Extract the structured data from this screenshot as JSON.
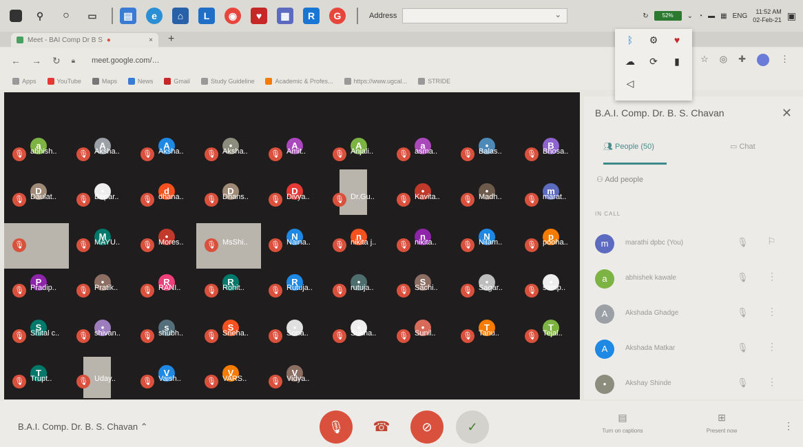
{
  "taskbar": {
    "address_label": "Address",
    "battery": "52%",
    "lang": "ENG",
    "time": "11:52 AM",
    "date": "02-Feb-21"
  },
  "browser": {
    "tab_title": "Meet - BAI Comp Dr B S",
    "url": "meet.google.com/…",
    "bookmarks": [
      "Apps",
      "YouTube",
      "Maps",
      "News",
      "Gmail",
      "Study Guideline",
      "Academic & Profes...",
      "https://www.ugcal...",
      "STRIDE"
    ]
  },
  "grid": [
    {
      "row": 0,
      "tiles": [
        {
          "l": "a",
          "n": "abhish..",
          "c": "#7cb342"
        },
        {
          "l": "A",
          "n": "Aksha..",
          "c": "#9aa0a6"
        },
        {
          "l": "A",
          "n": "Aksha..",
          "c": "#1e88e5"
        },
        {
          "l": "•",
          "n": "Aksha..",
          "c": "#8d8d7d"
        },
        {
          "l": "A",
          "n": "Amit..",
          "c": "#ab47bc"
        },
        {
          "l": "A",
          "n": "Anjali..",
          "c": "#7cb342"
        },
        {
          "l": "a",
          "n": "asma..",
          "c": "#ab47bc"
        },
        {
          "l": "•",
          "n": "Balas..",
          "c": "#4e8ab8"
        },
        {
          "l": "B",
          "n": "Bhosa..",
          "c": "#8e63ce"
        }
      ]
    },
    {
      "row": 1,
      "tiles": [
        {
          "l": "D",
          "n": "Daulat..",
          "c": "#9e8a76"
        },
        {
          "l": "•",
          "n": "Depar..",
          "c": "#eeeeee"
        },
        {
          "l": "d",
          "n": "dhana..",
          "c": "#f4511e"
        },
        {
          "l": "D",
          "n": "Dhans..",
          "c": "#9e8a76"
        },
        {
          "l": "D",
          "n": "Divya..",
          "c": "#e53935"
        },
        {
          "l": "",
          "n": "Dr.Gu..",
          "c": "#b9b5ad"
        },
        {
          "l": "•",
          "n": "Kavita..",
          "c": "#c0392b"
        },
        {
          "l": "•",
          "n": "Madh..",
          "c": "#6d5a4a"
        },
        {
          "l": "m",
          "n": "marat..",
          "c": "#5c6bc0"
        }
      ]
    },
    {
      "row": 2,
      "tiles": [
        {
          "l": "",
          "n": "",
          "c": "#b9b5ad"
        },
        {
          "l": "M",
          "n": "MAYU..",
          "c": "#00796b"
        },
        {
          "l": "•",
          "n": "Mores..",
          "c": "#c0392b"
        },
        {
          "l": "",
          "n": "MsShi..",
          "c": "#b9b5ad"
        },
        {
          "l": "N",
          "n": "Naina..",
          "c": "#1e88e5"
        },
        {
          "l": "n",
          "n": "nikita j..",
          "c": "#f4511e"
        },
        {
          "l": "n",
          "n": "nikita..",
          "c": "#8e24aa"
        },
        {
          "l": "N",
          "n": "Nilam..",
          "c": "#1e88e5"
        },
        {
          "l": "p",
          "n": "pooha..",
          "c": "#f57c00"
        }
      ]
    },
    {
      "row": 3,
      "tiles": [
        {
          "l": "P",
          "n": "Pradip..",
          "c": "#8e24aa"
        },
        {
          "l": "•",
          "n": "Pratik..",
          "c": "#8d6e63"
        },
        {
          "l": "R",
          "n": "RANI..",
          "c": "#ec407a"
        },
        {
          "l": "R",
          "n": "Rohit..",
          "c": "#00796b"
        },
        {
          "l": "R",
          "n": "Rutuja..",
          "c": "#1e88e5"
        },
        {
          "l": "•",
          "n": "rutuja..",
          "c": "#4e6e6e"
        },
        {
          "l": "S",
          "n": "Sachi..",
          "c": "#8d6e63"
        },
        {
          "l": "•",
          "n": "Sagar..",
          "c": "#bdbdbd"
        },
        {
          "l": "•",
          "n": "samp..",
          "c": "#eeeeee"
        }
      ]
    },
    {
      "row": 4,
      "tiles": [
        {
          "l": "S",
          "n": "Shital c..",
          "c": "#00796b"
        },
        {
          "l": "•",
          "n": "shivan..",
          "c": "#9e7dbe"
        },
        {
          "l": "s",
          "n": "shubh..",
          "c": "#546e7a"
        },
        {
          "l": "S",
          "n": "Sneha..",
          "c": "#f4511e"
        },
        {
          "l": "•",
          "n": "Sona..",
          "c": "#e0e0e0"
        },
        {
          "l": "•",
          "n": "Sukha..",
          "c": "#eeeeee"
        },
        {
          "l": "•",
          "n": "Sunil..",
          "c": "#d86a5a"
        },
        {
          "l": "T",
          "n": "Tanu..",
          "c": "#f57c00"
        },
        {
          "l": "T",
          "n": "Tejal..",
          "c": "#7cb342"
        }
      ]
    },
    {
      "row": 5,
      "tiles": [
        {
          "l": "T",
          "n": "Trupt..",
          "c": "#00796b"
        },
        {
          "l": "",
          "n": "Uday..",
          "c": "#b9b5ad"
        },
        {
          "l": "V",
          "n": "Vaish..",
          "c": "#1e88e5"
        },
        {
          "l": "V",
          "n": "VARS..",
          "c": "#f57c00"
        },
        {
          "l": "V",
          "n": "Vidya..",
          "c": "#8d6e63"
        }
      ]
    }
  ],
  "sidebar": {
    "title": "B.A.I. Comp. Dr. B. S. Chavan",
    "people_tab": "People (50)",
    "chat_tab": "Chat",
    "add_people": "Add people",
    "in_call": "IN CALL",
    "participants": [
      {
        "letter": "m",
        "name": "marathi dpbc (You)",
        "color": "#5c6bc0"
      },
      {
        "letter": "a",
        "name": "abhishek kawale",
        "color": "#7cb342"
      },
      {
        "letter": "A",
        "name": "Akshada Ghadge",
        "color": "#9aa0a6"
      },
      {
        "letter": "A",
        "name": "Akshada Matkar",
        "color": "#1e88e5"
      },
      {
        "letter": "•",
        "name": "Akshay Shinde",
        "color": "#8d8d7d"
      }
    ]
  },
  "bottom": {
    "meeting_name": "B.A.I. Comp. Dr. B. S. Chavan",
    "captions": "Turn on captions",
    "present": "Present now"
  }
}
